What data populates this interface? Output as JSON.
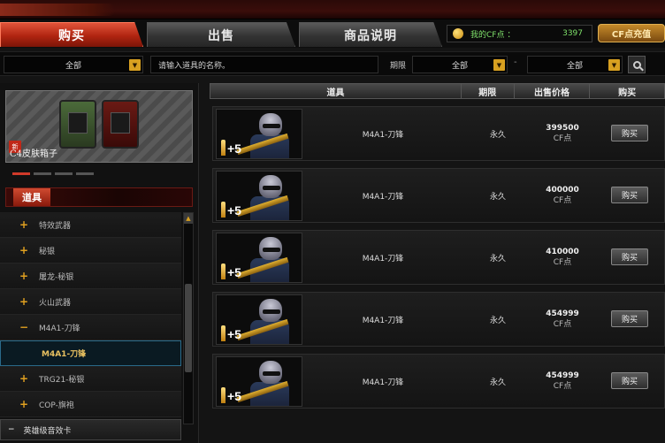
{
  "tabs": [
    {
      "label": "购买",
      "active": true
    },
    {
      "label": "出售",
      "active": false
    },
    {
      "label": "商品说明",
      "active": false
    }
  ],
  "cf_points": {
    "label": "我的CF点 ：",
    "value": "3397"
  },
  "recharge_label": "CF点充值",
  "filters": {
    "category": "全部",
    "search_placeholder": "请输入道具的名称。",
    "period_label": "期限",
    "period_value": "全部",
    "dash": "-",
    "price_value": "全部"
  },
  "banner": {
    "caption": "C4皮肤箱子",
    "new_tag": "新"
  },
  "sidebar": {
    "header": "道具",
    "items": [
      {
        "label": "特效武器",
        "toggle": "+"
      },
      {
        "label": "秘银",
        "toggle": "+"
      },
      {
        "label": "屠龙-秘银",
        "toggle": "+"
      },
      {
        "label": "火山武器",
        "toggle": "+"
      },
      {
        "label": "M4A1-刀锋",
        "toggle": "−"
      },
      {
        "label": "M4A1-刀锋",
        "sub": true
      },
      {
        "label": "TRG21-秘银",
        "toggle": "+"
      },
      {
        "label": "COP-旗袍",
        "toggle": "+"
      }
    ],
    "bottom": {
      "label": "英雄级音效卡",
      "toggle": "−"
    }
  },
  "table": {
    "headers": [
      "道具",
      "期限",
      "出售价格",
      "购买"
    ],
    "rows": [
      {
        "bonus": "+5",
        "name": "M4A1-刀锋",
        "period": "永久",
        "price": "399500",
        "unit": "CF点",
        "buy": "购买"
      },
      {
        "bonus": "+5",
        "name": "M4A1-刀锋",
        "period": "永久",
        "price": "400000",
        "unit": "CF点",
        "buy": "购买"
      },
      {
        "bonus": "+5",
        "name": "M4A1-刀锋",
        "period": "永久",
        "price": "410000",
        "unit": "CF点",
        "buy": "购买"
      },
      {
        "bonus": "+5",
        "name": "M4A1-刀锋",
        "period": "永久",
        "price": "454999",
        "unit": "CF点",
        "buy": "购买"
      },
      {
        "bonus": "+5",
        "name": "M4A1-刀锋",
        "period": "永久",
        "price": "454999",
        "unit": "CF点",
        "buy": "购买"
      }
    ]
  },
  "colors": {
    "accent": "#b02410",
    "points": "#7ee06a",
    "gold": "#d8a020"
  }
}
